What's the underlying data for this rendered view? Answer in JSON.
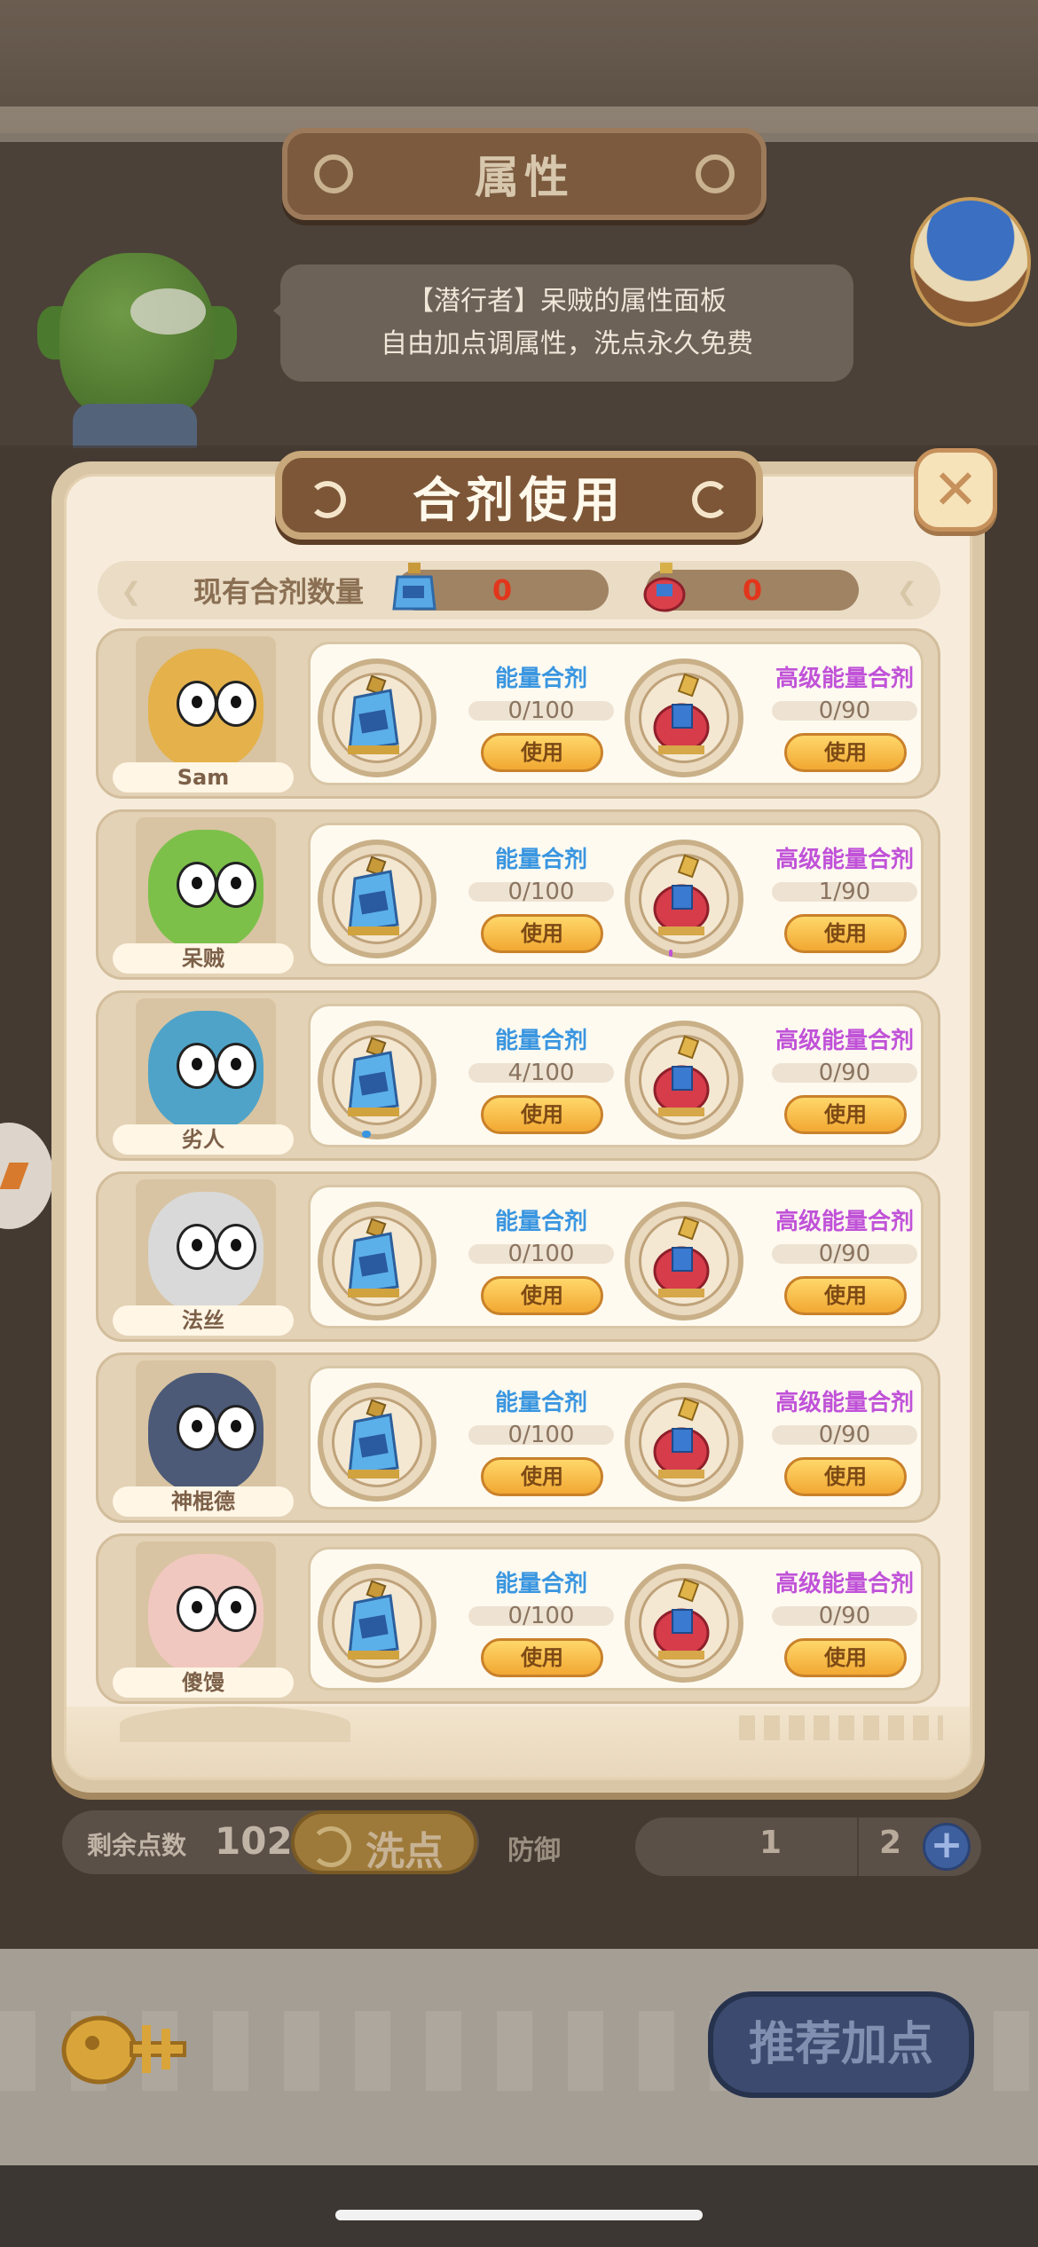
{
  "page": {
    "title": "属性",
    "speech_line1": "【潜行者】呆贼的属性面板",
    "speech_line2": "自由加点调属性，洗点永久免费"
  },
  "modal": {
    "title": "合剂使用",
    "close_icon": "close-icon",
    "stock_label": "现有合剂数量",
    "stock_energy": "0",
    "stock_advanced": "0",
    "potion_blue_name": "能量合剂",
    "potion_red_name": "高级能量合剂",
    "use_label": "使用",
    "rows": [
      {
        "name": "Sam",
        "energy": "0/100",
        "advanced": "0/90",
        "energy_progress": 0,
        "advanced_progress": 0
      },
      {
        "name": "呆贼",
        "energy": "0/100",
        "advanced": "1/90",
        "energy_progress": 0,
        "advanced_progress": 0.011
      },
      {
        "name": "劣人",
        "energy": "4/100",
        "advanced": "0/90",
        "energy_progress": 0.04,
        "advanced_progress": 0
      },
      {
        "name": "法丝",
        "energy": "0/100",
        "advanced": "0/90",
        "energy_progress": 0,
        "advanced_progress": 0
      },
      {
        "name": "神棍德",
        "energy": "0/100",
        "advanced": "0/90",
        "energy_progress": 0,
        "advanced_progress": 0
      },
      {
        "name": "傻馒",
        "energy": "0/100",
        "advanced": "0/90",
        "energy_progress": 0,
        "advanced_progress": 0
      }
    ]
  },
  "footer": {
    "points_label": "剩余点数",
    "points_value": "102",
    "reset_label": "洗点",
    "defense_label": "防御",
    "defense_current": "1",
    "defense_next": "2",
    "recommend_label": "推荐加点"
  },
  "colors": {
    "energy_blue": "#3a96e0",
    "advanced_purple": "#c052d8",
    "stock_red": "#e2361c",
    "button_gold": "#f1a832"
  }
}
